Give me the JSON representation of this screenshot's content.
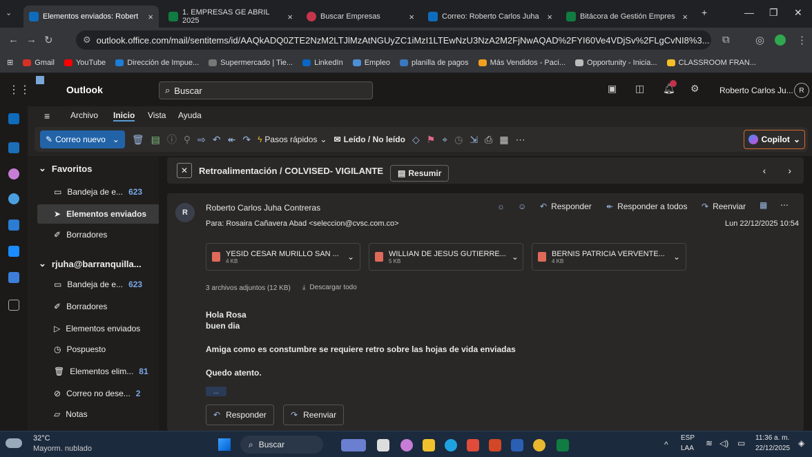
{
  "tabs": [
    {
      "label": "Elementos enviados: Robert",
      "color": "#0f6cbd",
      "active": true
    },
    {
      "label": "1. EMPRESAS GE ABRIL 2025",
      "color": "#107c41"
    },
    {
      "label": "Buscar Empresas",
      "color": "#c7354d"
    },
    {
      "label": "Correo: Roberto Carlos Juha",
      "color": "#0f6cbd"
    },
    {
      "label": "Bitácora de Gestión Empres",
      "color": "#107c41"
    }
  ],
  "address": {
    "url": "outlook.office.com/mail/sentitems/id/AAQkADQ0ZTE2NzM2LTJlMzAtNGUyZC1iMzI1LTEwNzU3NzA2M2FjNwAQAD%2FYI60Ve4VDjSv%2FLgCvNI8%3..."
  },
  "bookmarks": [
    "Gmail",
    "YouTube",
    "Dirección de Impue...",
    "Supermercado | Tie...",
    "LinkedIn",
    "Empleo",
    "planilla de pagos",
    "Más Vendidos - Paci...",
    "Opportunity - Inicia...",
    "CLASSROOM FRAN..."
  ],
  "header": {
    "app": "Outlook",
    "search_placeholder": "Buscar",
    "user": "Roberto Carlos Ju...",
    "avatar": "R"
  },
  "menus": [
    "Archivo",
    "Inicio",
    "Vista",
    "Ayuda"
  ],
  "toolbar": {
    "new_mail": "Correo nuevo",
    "quick_steps": "Pasos rápidos",
    "read_unread": "Leído / No leído",
    "copilot": "Copilot"
  },
  "folders": {
    "favorites_title": "Favoritos",
    "fav": [
      {
        "label": "Bandeja de e...",
        "count": "623"
      },
      {
        "label": "Elementos enviados",
        "count": ""
      },
      {
        "label": "Borradores",
        "count": ""
      }
    ],
    "account": "rjuha@barranquilla...",
    "acc": [
      {
        "label": "Bandeja de e...",
        "count": "623"
      },
      {
        "label": "Borradores",
        "count": ""
      },
      {
        "label": "Elementos enviados",
        "count": ""
      },
      {
        "label": "Pospuesto",
        "count": ""
      },
      {
        "label": "Elementos elim...",
        "count": "81"
      },
      {
        "label": "Correo no dese...",
        "count": "2"
      },
      {
        "label": "Notas",
        "count": ""
      }
    ]
  },
  "message": {
    "subject": "Retroalimentación / COLVISED- VIGILANTE",
    "summarize": "Resumir",
    "sender": "Roberto Carlos Juha Contreras",
    "avatar": "R",
    "to": "Para:  Rosaira Cañavera Abad <seleccion@cvsc.com.co>",
    "date": "Lun 22/12/2025 10:54",
    "reply": "Responder",
    "reply_all": "Responder a todos",
    "forward": "Reenviar",
    "attachments": [
      {
        "name": "YESID CESAR MURILLO SAN ...",
        "size": "4 KB"
      },
      {
        "name": "WILLIAN DE JESUS GUTIERRE...",
        "size": "5 KB"
      },
      {
        "name": "BERNIS PATRICIA VERVENTE...",
        "size": "4 KB"
      }
    ],
    "attach_summary": "3 archivos adjuntos (12 KB)",
    "download_all": "Descargar todo",
    "body": [
      "Hola Rosa",
      "buen dia",
      "Amiga como es constumbre se requiere retro sobre las hojas de vida enviadas",
      "Quedo atento."
    ],
    "ellipsis": "...",
    "btn_reply": "Responder",
    "btn_forward": "Reenviar"
  },
  "taskbar": {
    "temp": "32°C",
    "weather": "Mayorm. nublado",
    "search": "Buscar",
    "lang": "ESP",
    "lang2": "LAA",
    "time": "11:36 a. m.",
    "date": "22/12/2025"
  }
}
